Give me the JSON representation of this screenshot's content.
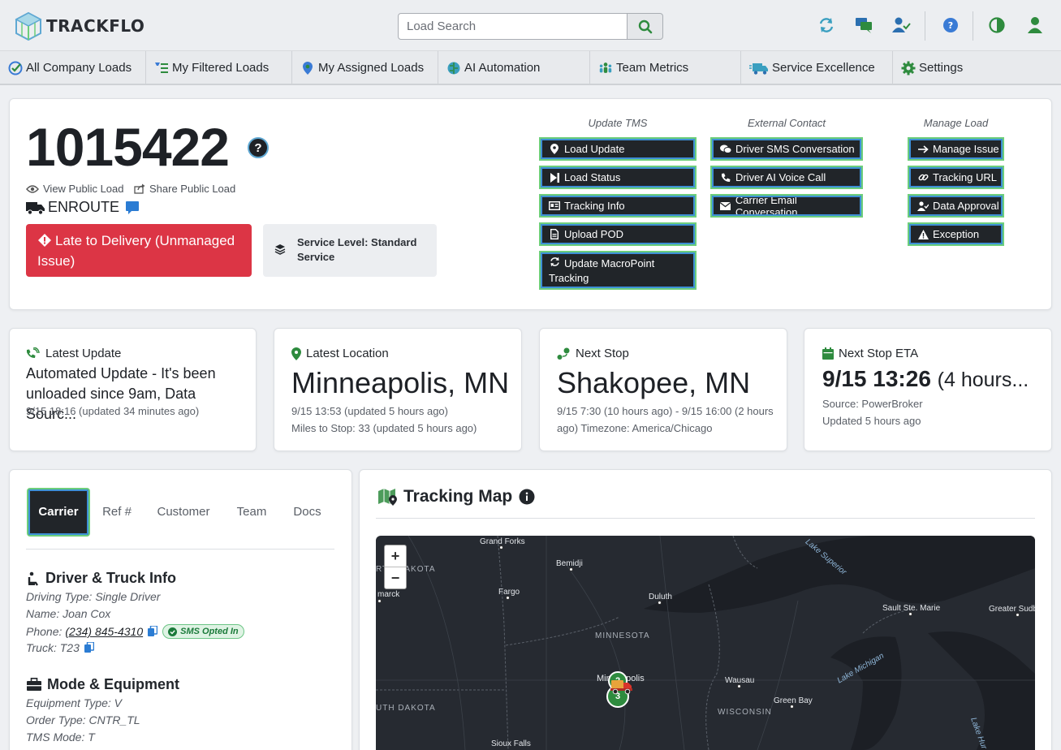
{
  "app": {
    "name": "TRACKFLO"
  },
  "search": {
    "placeholder": "Load Search"
  },
  "header_icons": [
    "refresh-icon",
    "chat-icon",
    "user-check-icon",
    "help-icon",
    "contrast-icon",
    "user-icon"
  ],
  "nav": [
    {
      "label": "All Company Loads",
      "icon": "check-circle-icon"
    },
    {
      "label": "My Filtered Loads",
      "icon": "filter-list-icon"
    },
    {
      "label": "My Assigned Loads",
      "icon": "map-pin-icon"
    },
    {
      "label": "AI Automation",
      "icon": "brain-icon"
    },
    {
      "label": "Team Metrics",
      "icon": "team-icon"
    },
    {
      "label": "Service Excellence",
      "icon": "truck-fast-icon"
    },
    {
      "label": "Settings",
      "icon": "gear-icon"
    }
  ],
  "load": {
    "id": "1015422",
    "help": "?",
    "view_public": "View Public Load",
    "share_public": "Share Public Load",
    "status": "ENROUTE",
    "alert": "Late to Delivery (Unmanaged Issue)",
    "service_level": "Service Level: Standard Service"
  },
  "actions": {
    "update_tms": {
      "title": "Update TMS",
      "buttons": [
        "Load Update",
        "Load Status",
        "Tracking Info",
        "Upload POD",
        "Update MacroPoint Tracking"
      ]
    },
    "external_contact": {
      "title": "External Contact",
      "buttons": [
        "Driver SMS Conversation",
        "Driver AI Voice Call",
        "Carrier Email Conversation"
      ]
    },
    "manage_load": {
      "title": "Manage Load",
      "buttons": [
        "Manage Issue",
        "Tracking URL",
        "Data Approval",
        "Exception"
      ]
    }
  },
  "summary": {
    "latest_update": {
      "label": "Latest Update",
      "text": "Automated Update - It's been unloaded since 9am, Data Sourc...",
      "sub": "9/15 18:16 (updated 34 minutes ago)"
    },
    "latest_location": {
      "label": "Latest Location",
      "value": "Minneapolis, MN",
      "sub1": "9/15 13:53 (updated 5 hours ago)",
      "sub2": "Miles to Stop: 33 (updated 5 hours ago)"
    },
    "next_stop": {
      "label": "Next Stop",
      "value": "Shakopee, MN",
      "sub1": "9/15 7:30 (10 hours ago) - 9/15 16:00 (2 hours",
      "sub2": "ago) Timezone: America/Chicago"
    },
    "next_stop_eta": {
      "label": "Next Stop ETA",
      "value": "9/15 13:26",
      "value_rel": "(4 hours...",
      "sub1": "Source: PowerBroker",
      "sub2": "Updated 5 hours ago"
    }
  },
  "tabs": [
    "Carrier",
    "Ref #",
    "Customer",
    "Team",
    "Docs"
  ],
  "carrier": {
    "driver_title": "Driver & Truck Info",
    "driving_type": "Driving Type: Single Driver",
    "name": "Name: Joan Cox",
    "phone_label": "Phone:",
    "phone": "(234) 845-4310",
    "sms_badge": "SMS Opted In",
    "truck": "Truck: T23",
    "mode_title": "Mode & Equipment",
    "equipment": "Equipment Type: V",
    "order_type": "Order Type: CNTR_TL",
    "tms_mode": "TMS Mode: T"
  },
  "map": {
    "title": "Tracking Map",
    "zoom_in": "+",
    "zoom_out": "−",
    "labels": {
      "grand_forks": "Grand Forks",
      "bemidji": "Bemidji",
      "fargo": "Fargo",
      "duluth": "Duluth",
      "minnesota": "MINNESOTA",
      "minneapolis": "Minneapolis",
      "wausau": "Wausau",
      "green_bay": "Green Bay",
      "wisconsin": "WISCONSIN",
      "north_dakota": "RTH DAKOTA",
      "bismarck": "marck",
      "south_dakota": "UTH DAKOTA",
      "sioux_falls": "Sioux Falls",
      "lake_superior": "Lake Superior",
      "sault": "Sault Ste. Marie",
      "greater_sudbury": "Greater Sudb",
      "lake_michigan": "Lake Michigan",
      "lake_huron": "Lake Hur"
    },
    "markers": [
      "2",
      "3"
    ]
  },
  "colors": {
    "accent_green": "#6dce7b",
    "accent_blue": "#3d8fd6",
    "danger": "#dc3545",
    "dark": "#212529"
  }
}
